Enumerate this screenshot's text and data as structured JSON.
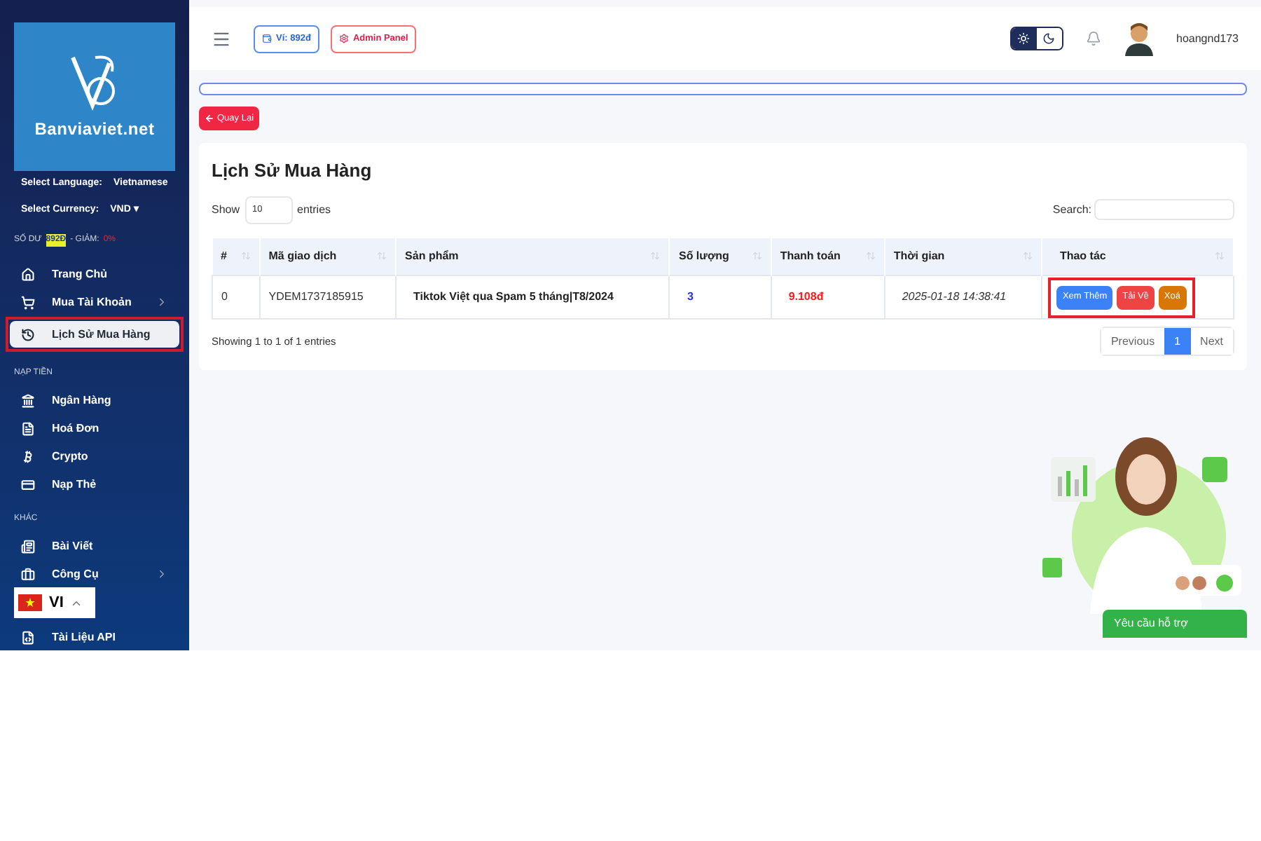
{
  "sidebar": {
    "logo_text": "Banviaviet.net",
    "language_label": "Select Language:",
    "language": "Vietnamese",
    "currency_label": "Select Currency:",
    "currency": "VND",
    "currency_caret": "▾",
    "balance_label": "SỐ DƯ",
    "balance": "892Đ",
    "discount_label": "- GIẢM:",
    "discount": "0%",
    "sections": [
      {
        "items": [
          {
            "label": "Trang Chủ",
            "selected": false,
            "has_submenu": false,
            "highlighted": false
          },
          {
            "label": "Mua Tài Khoản",
            "selected": false,
            "has_submenu": true,
            "highlighted": false
          },
          {
            "label": "Lịch Sử Mua Hàng",
            "selected": true,
            "has_submenu": false,
            "highlighted": true
          }
        ]
      },
      {
        "title": "NẠP TIỀN",
        "items": [
          {
            "label": "Ngân Hàng",
            "selected": false,
            "has_submenu": false,
            "highlighted": false
          },
          {
            "label": "Hoá Đơn",
            "selected": false,
            "has_submenu": false,
            "highlighted": false
          },
          {
            "label": "Crypto",
            "selected": false,
            "has_submenu": false,
            "highlighted": false
          },
          {
            "label": "Nạp Thẻ",
            "selected": false,
            "has_submenu": false,
            "highlighted": false
          }
        ]
      },
      {
        "title": "KHÁC",
        "items": [
          {
            "label": "Bài Viết",
            "selected": false,
            "has_submenu": false,
            "highlighted": false
          },
          {
            "label": "Công Cụ",
            "selected": false,
            "has_submenu": true,
            "highlighted": false
          },
          {
            "label": "Tài Liệu API",
            "selected": false,
            "has_submenu": false,
            "highlighted": false
          }
        ]
      }
    ]
  },
  "language_switcher": {
    "label": "VI"
  },
  "header": {
    "wallet": "Ví: 892đ",
    "admin": "Admin Panel",
    "light_mode": true,
    "username": "hoangnd173"
  },
  "back_button": "Quay Lại",
  "card": {
    "title": "Lịch Sử Mua Hàng",
    "show_label": "Show",
    "page_size": "10",
    "entries_label": "entries",
    "search_label": "Search:",
    "columns": [
      "#",
      "Mã giao dịch",
      "Sản phẩm",
      "Số lượng",
      "Thanh toán",
      "Thời gian",
      "Thao tác"
    ],
    "rows": [
      {
        "cells": [
          {
            "kind": "plain",
            "text": "0"
          },
          {
            "kind": "plain",
            "text": "YDEM1737185915"
          },
          {
            "kind": "bold",
            "text": "Tiktok Việt qua Spam 5 tháng|T8/2024"
          },
          {
            "kind": "quantity",
            "text": "3"
          },
          {
            "kind": "amount",
            "text": "9.108đ"
          },
          {
            "kind": "datetime",
            "text": "2025-01-18 14:38:41"
          }
        ],
        "actions_highlighted": true,
        "actions": [
          {
            "label": "Xem Thêm",
            "color": "#3b82f6"
          },
          {
            "label": "Tải Về",
            "color": "#ef4444"
          },
          {
            "label": "Xoá",
            "color": "#d97706"
          }
        ]
      }
    ],
    "info": "Showing 1 to 1 of 1 entries",
    "pagination": [
      {
        "label": "Previous",
        "selected": false
      },
      {
        "label": "1",
        "selected": true
      },
      {
        "label": "Next",
        "selected": false
      }
    ]
  },
  "support": {
    "button": "Yêu cầu hỗ trợ"
  }
}
